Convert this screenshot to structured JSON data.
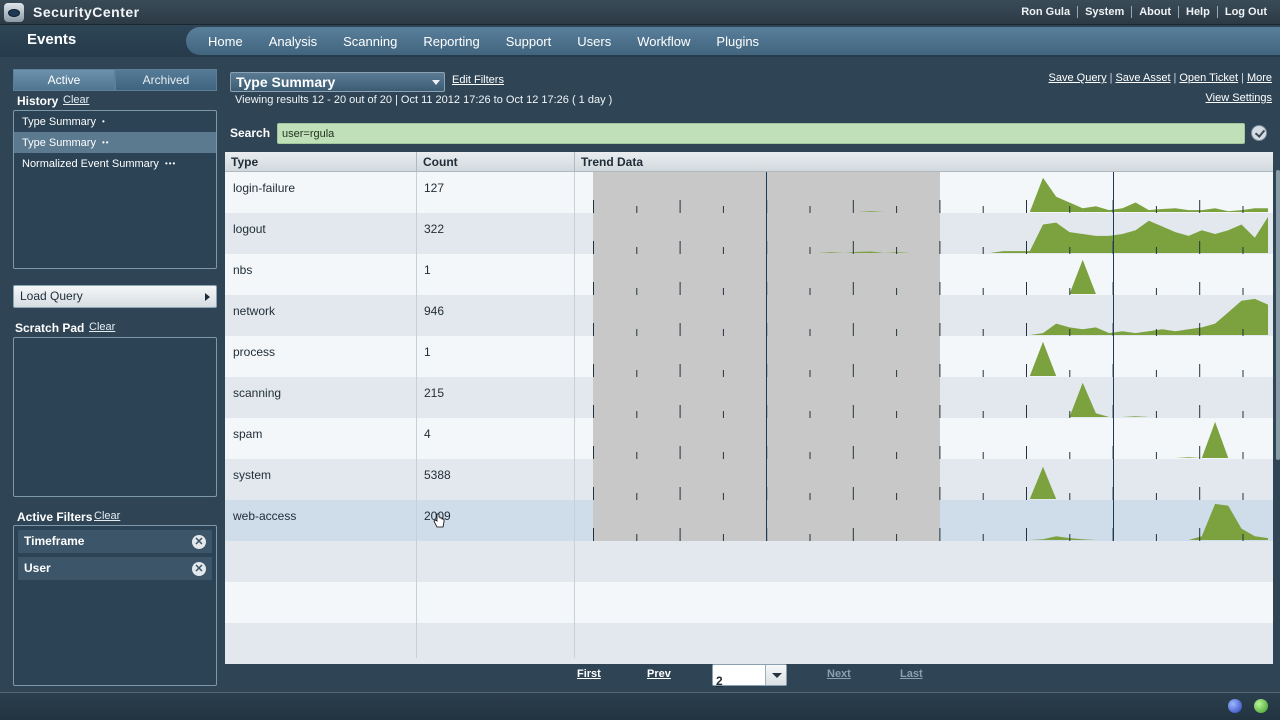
{
  "app": {
    "name": "SecurityCenter",
    "page_title": "Events"
  },
  "user_menu": [
    "Ron Gula",
    "System",
    "About",
    "Help",
    "Log Out"
  ],
  "nav": [
    "Home",
    "Analysis",
    "Scanning",
    "Reporting",
    "Support",
    "Users",
    "Workflow",
    "Plugins"
  ],
  "left": {
    "tab_active": "Active",
    "tab_archived": "Archived",
    "history_label": "History",
    "history_clear": "Clear",
    "history": [
      {
        "label": "Type Summary",
        "dots": "•"
      },
      {
        "label": "Type Summary",
        "dots": "••"
      },
      {
        "label": "Normalized Event Summary",
        "dots": "•••"
      }
    ],
    "load_query": "Load Query",
    "scratch_label": "Scratch Pad",
    "scratch_clear": "Clear",
    "filters_label": "Active Filters",
    "filters_clear": "Clear",
    "filters": [
      "Timeframe",
      "User"
    ]
  },
  "content": {
    "tool": "Type Summary",
    "edit_filters": "Edit Filters",
    "viewing": "Viewing results 12 - 20 out of 20  |  Oct 11 2012 17:26 to Oct 12 17:26  ( 1 day )",
    "actions": [
      "Save Query",
      "Save Asset",
      "Open Ticket",
      "More"
    ],
    "view_settings": "View Settings",
    "search_label": "Search",
    "search_value": "user=rgula",
    "columns": [
      "Type",
      "Count",
      "Trend Data"
    ],
    "rows": [
      {
        "type": "login-failure",
        "count": "127",
        "trend": [
          0,
          0,
          0,
          0,
          0,
          0,
          0,
          0,
          0,
          0,
          0,
          0,
          0,
          0,
          0,
          0,
          0,
          0,
          0,
          0,
          0,
          0.02,
          0,
          0,
          0,
          0,
          0,
          0,
          0,
          0,
          0,
          0,
          0,
          0,
          0.9,
          0.4,
          0.25,
          0.1,
          0.15,
          0.05,
          0.1,
          0.25,
          0.05,
          0.08,
          0.1,
          0.05,
          0.05,
          0.1,
          0.02,
          0.05,
          0.1,
          0.1
        ]
      },
      {
        "type": "logout",
        "count": "322",
        "trend": [
          0,
          0,
          0,
          0,
          0,
          0,
          0,
          0,
          0,
          0,
          0,
          0,
          0,
          0,
          0,
          0,
          0,
          0,
          0.02,
          0,
          0.03,
          0.04,
          0,
          0.02,
          0,
          0,
          0,
          0,
          0,
          0,
          0,
          0.05,
          0.05,
          0.05,
          0.75,
          0.8,
          0.55,
          0.5,
          0.45,
          0.45,
          0.5,
          0.6,
          0.85,
          0.7,
          0.55,
          0.45,
          0.6,
          0.5,
          0.6,
          0.75,
          0.4,
          0.95
        ]
      },
      {
        "type": "nbs",
        "count": "1",
        "trend": [
          0,
          0,
          0,
          0,
          0,
          0,
          0,
          0,
          0,
          0,
          0,
          0,
          0,
          0,
          0,
          0,
          0,
          0,
          0,
          0,
          0,
          0,
          0,
          0,
          0,
          0,
          0,
          0,
          0,
          0,
          0,
          0,
          0,
          0,
          0,
          0,
          0,
          0.9,
          0,
          0,
          0,
          0,
          0,
          0,
          0,
          0,
          0,
          0,
          0,
          0,
          0,
          0
        ]
      },
      {
        "type": "network",
        "count": "946",
        "trend": [
          0,
          0,
          0,
          0,
          0,
          0,
          0,
          0,
          0,
          0,
          0,
          0,
          0,
          0,
          0,
          0,
          0,
          0,
          0,
          0,
          0,
          0,
          0,
          0,
          0,
          0,
          0,
          0,
          0,
          0,
          0,
          0,
          0,
          0,
          0.05,
          0.3,
          0.2,
          0.15,
          0.2,
          0.05,
          0.1,
          0.05,
          0.1,
          0.15,
          0.1,
          0.15,
          0.2,
          0.3,
          0.6,
          0.9,
          0.95,
          0.8
        ]
      },
      {
        "type": "process",
        "count": "1",
        "trend": [
          0,
          0,
          0,
          0,
          0,
          0,
          0,
          0,
          0,
          0,
          0,
          0,
          0,
          0,
          0,
          0,
          0,
          0,
          0,
          0,
          0,
          0,
          0,
          0,
          0,
          0,
          0,
          0,
          0,
          0,
          0,
          0,
          0,
          0,
          0.9,
          0,
          0,
          0,
          0,
          0,
          0,
          0,
          0,
          0,
          0,
          0,
          0,
          0,
          0,
          0,
          0,
          0
        ]
      },
      {
        "type": "scanning",
        "count": "215",
        "trend": [
          0,
          0,
          0,
          0,
          0,
          0,
          0,
          0,
          0,
          0,
          0,
          0,
          0,
          0,
          0,
          0,
          0,
          0,
          0,
          0,
          0,
          0,
          0,
          0,
          0,
          0,
          0,
          0,
          0,
          0,
          0,
          0,
          0,
          0,
          0,
          0,
          0,
          0.9,
          0.1,
          0,
          0,
          0.02,
          0,
          0,
          0,
          0,
          0,
          0,
          0,
          0,
          0,
          0
        ]
      },
      {
        "type": "spam",
        "count": "4",
        "trend": [
          0,
          0,
          0,
          0,
          0,
          0,
          0,
          0,
          0,
          0,
          0,
          0,
          0,
          0,
          0,
          0,
          0,
          0,
          0,
          0,
          0,
          0,
          0,
          0,
          0,
          0,
          0,
          0,
          0,
          0,
          0,
          0,
          0,
          0,
          0,
          0,
          0,
          0,
          0,
          0,
          0,
          0,
          0,
          0,
          0,
          0.02,
          0,
          0.95,
          0,
          0,
          0,
          0
        ]
      },
      {
        "type": "system",
        "count": "5388",
        "trend": [
          0,
          0,
          0,
          0,
          0,
          0,
          0,
          0,
          0,
          0,
          0,
          0,
          0,
          0,
          0,
          0,
          0,
          0,
          0,
          0,
          0,
          0,
          0,
          0,
          0,
          0,
          0,
          0,
          0,
          0,
          0,
          0,
          0,
          0,
          0.85,
          0,
          0,
          0,
          0,
          0,
          0,
          0,
          0,
          0,
          0,
          0,
          0,
          0,
          0,
          0,
          0,
          0
        ]
      },
      {
        "type": "web-access",
        "count": "2009",
        "trend": [
          0,
          0,
          0,
          0,
          0,
          0,
          0,
          0,
          0,
          0,
          0,
          0,
          0,
          0,
          0,
          0,
          0,
          0,
          0,
          0,
          0,
          0,
          0,
          0,
          0,
          0,
          0,
          0,
          0,
          0,
          0,
          0,
          0,
          0,
          0.02,
          0.1,
          0.05,
          0.02,
          0,
          0,
          0,
          0,
          0,
          0,
          0,
          0,
          0.1,
          0.95,
          0.9,
          0.3,
          0.1,
          0.05
        ]
      }
    ],
    "pager": {
      "first": "First",
      "prev": "Prev",
      "page": "2",
      "next": "Next",
      "last": "Last"
    }
  },
  "colors": {
    "trend_fill": "#7ba23f",
    "shade": "#c8c8c8",
    "search_bg": "#bfe0b9",
    "nav_bg": "#4f7590"
  }
}
